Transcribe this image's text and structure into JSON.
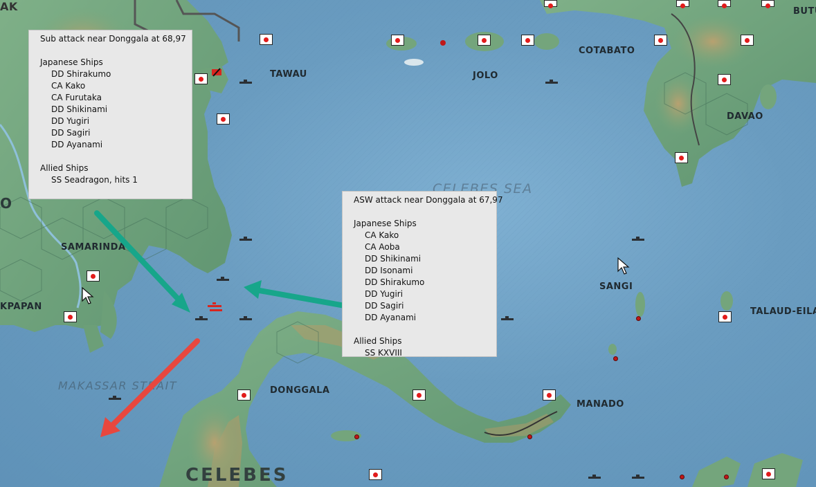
{
  "map": {
    "sea_labels": [
      "CELEBES SEA",
      "MAKASSAR STRAIT"
    ],
    "region_label": "CELEBES",
    "place_labels": {
      "tawau": "TAWAU",
      "jolo": "JOLO",
      "cotabato": "COTABATO",
      "davao": "DAVAO",
      "samarinda": "SAMARINDA",
      "balikpapan": "KPAPAN",
      "sangi": "SANGI",
      "talaud": "TALAUD-EILA",
      "donggala": "DONGGALA",
      "manado": "MANADO",
      "butuan": "BUTU",
      "top_left": "AK",
      "left_edge": "O"
    }
  },
  "sub_attack_report": {
    "title": "Sub attack near Donggala  at 68,97",
    "japanese_header": "Japanese Ships",
    "japanese_ships": [
      "DD Shirakumo",
      "CA Kako",
      "CA Furutaka",
      "DD Shikinami",
      "DD Yugiri",
      "DD Sagiri",
      "DD Ayanami"
    ],
    "allied_header": "Allied Ships",
    "allied_ships": [
      "SS Seadragon, hits 1"
    ]
  },
  "asw_attack_report": {
    "title": "ASW attack near Donggala  at 67,97",
    "japanese_header": "Japanese Ships",
    "japanese_ships": [
      "CA Kako",
      "CA Aoba",
      "DD Shikinami",
      "DD Isonami",
      "DD Shirakumo",
      "DD Yugiri",
      "DD Sagiri",
      "DD Ayanami"
    ],
    "allied_header": "Allied Ships",
    "allied_ships": [
      "SS KXVIII"
    ]
  },
  "colors": {
    "sea": "#6a9cc0",
    "land": "#6fa27a",
    "arrow_green": "#17a68a",
    "arrow_red": "#e8473e",
    "base_marker": "#e21b1b"
  }
}
